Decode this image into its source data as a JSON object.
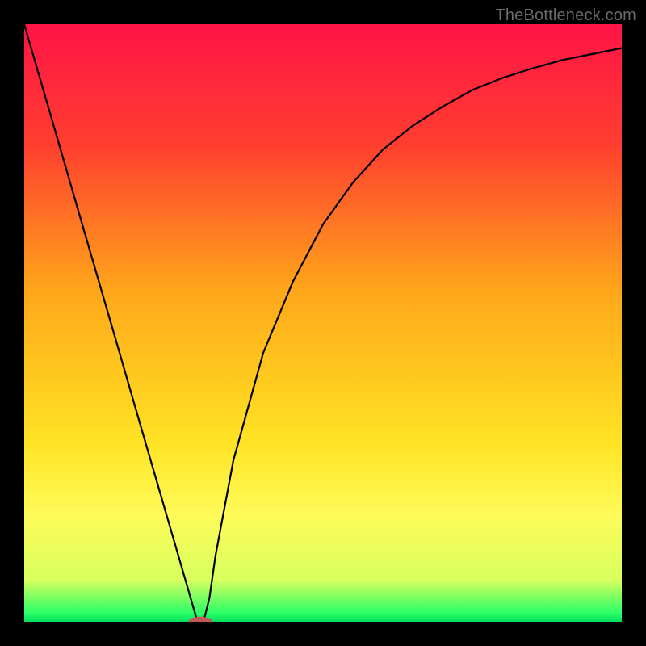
{
  "watermark": "TheBottleneck.com",
  "chart_data": {
    "type": "line",
    "title": "",
    "xlabel": "",
    "ylabel": "",
    "xlim": [
      0,
      1
    ],
    "ylim": [
      0,
      1
    ],
    "background_gradient": {
      "stops": [
        {
          "offset": 0.0,
          "color": "#ff1447"
        },
        {
          "offset": 0.2,
          "color": "#ff3e2f"
        },
        {
          "offset": 0.45,
          "color": "#ffa81a"
        },
        {
          "offset": 0.7,
          "color": "#ffe324"
        },
        {
          "offset": 0.82,
          "color": "#fffb59"
        },
        {
          "offset": 0.93,
          "color": "#d7ff5e"
        },
        {
          "offset": 0.985,
          "color": "#2cff67"
        },
        {
          "offset": 1.0,
          "color": "#00de5b"
        }
      ]
    },
    "series": [
      {
        "name": "bottleneck-curve",
        "x": [
          0.0,
          0.05,
          0.1,
          0.15,
          0.2,
          0.25,
          0.29,
          0.3,
          0.31,
          0.32,
          0.35,
          0.4,
          0.45,
          0.5,
          0.55,
          0.6,
          0.65,
          0.7,
          0.75,
          0.8,
          0.85,
          0.9,
          0.95,
          1.0
        ],
        "y": [
          1.0,
          0.828,
          0.655,
          0.483,
          0.31,
          0.138,
          0.0,
          0.0,
          0.04,
          0.11,
          0.27,
          0.45,
          0.57,
          0.665,
          0.735,
          0.79,
          0.83,
          0.862,
          0.89,
          0.91,
          0.926,
          0.94,
          0.95,
          0.96
        ]
      }
    ],
    "marker": {
      "name": "minimum-marker",
      "x": 0.295,
      "y": 0.0,
      "rx": 0.02,
      "ry": 0.0085,
      "color": "#c05a5a"
    }
  }
}
